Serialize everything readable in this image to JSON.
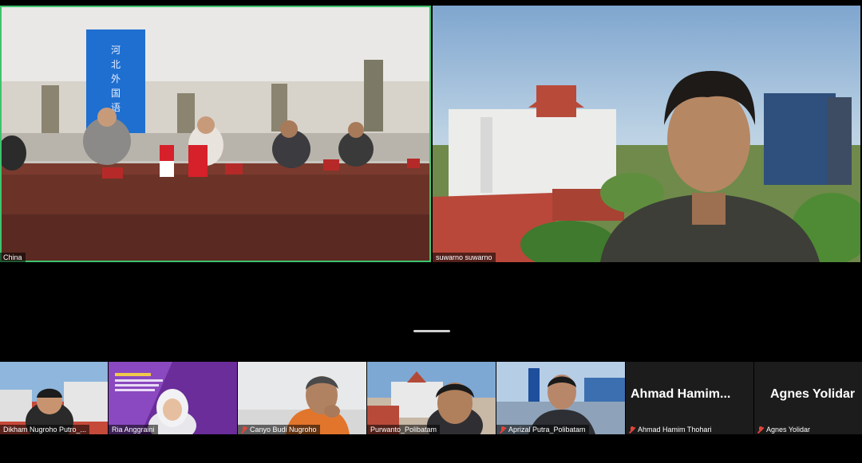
{
  "main_tiles": [
    {
      "name": "China"
    },
    {
      "name": "suwarno suwarno"
    }
  ],
  "gallery": [
    {
      "name": "Dikham Nugroho Putro_...",
      "muted": false
    },
    {
      "name": "Ria Anggraini",
      "muted": false
    },
    {
      "name": "Canyo Budi Nugroho",
      "muted": true
    },
    {
      "name": "Purwanto_Polibatam",
      "muted": false
    },
    {
      "name": "Aprizal Putra_Polibatam",
      "muted": true
    },
    {
      "name": "Ahmad Hamim Thohari",
      "display": "Ahmad  Hamim...",
      "muted": true
    },
    {
      "name": "Agnes Yolidar",
      "display": "Agnes Yolidar",
      "muted": true
    }
  ],
  "colors": {
    "active_speaker": "#3ec46d",
    "muted_icon": "#e0453a"
  }
}
